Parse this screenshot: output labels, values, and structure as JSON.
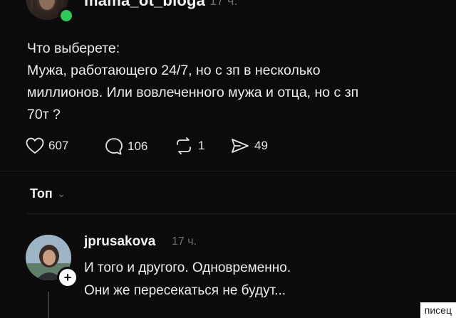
{
  "post": {
    "username": "mama_ot_bloga",
    "time": "17 ч.",
    "text_lines": [
      "Что выберете:",
      "Мужа, работающего 24/7, но с зп в несколько",
      "миллионов. Или вовлеченного мужа и отца, но с зп",
      "70т ?"
    ],
    "stats": {
      "likes": "607",
      "comments": "106",
      "reposts": "1",
      "shares": "49"
    }
  },
  "sort": {
    "label": "Топ"
  },
  "comment": {
    "username": "jprusakova",
    "time": "17 ч.",
    "text_lines": [
      "И того и другого. Одновременно.",
      "Они же пересекаться не будут..."
    ]
  },
  "watermark": "писец",
  "colors": {
    "online": "#2fc955",
    "background": "#0b0b0b",
    "muted": "#6f6f6f"
  }
}
